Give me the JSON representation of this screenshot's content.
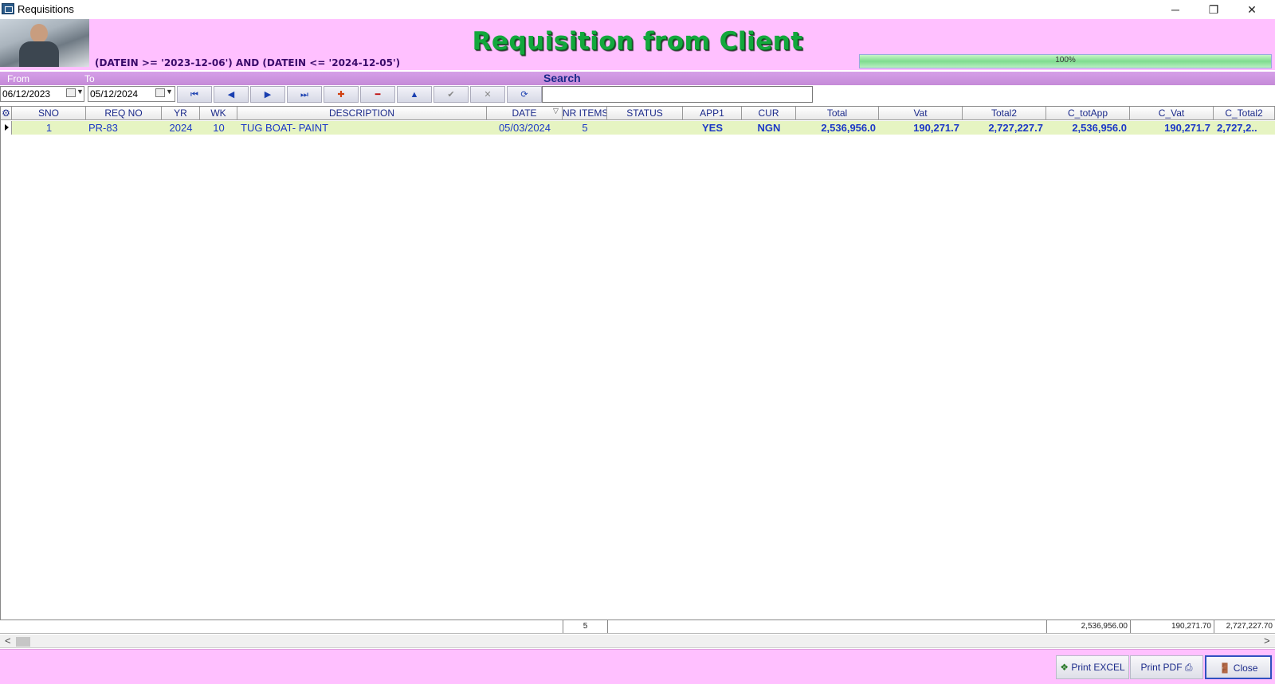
{
  "window": {
    "title": "Requisitions",
    "minimize_glyph": "─",
    "restore_glyph": "❐",
    "close_glyph": "✕"
  },
  "header": {
    "title": "Requisition from Client",
    "filter": "(DATEIN >= '2023-12-06') AND  (DATEIN  <= '2024-12-05')",
    "progress_label": "100%",
    "progress_value": 100
  },
  "search": {
    "from_label": "From",
    "to_label": "To",
    "label": "Search",
    "from_date": "06/12/2023",
    "to_date": "05/12/2024",
    "query": ""
  },
  "navigator": {
    "first": "⏮",
    "prior": "◀",
    "next": "▶",
    "last": "⏭",
    "insert": "✚",
    "delete": "━",
    "edit": "▲",
    "post": "✔",
    "cancel": "✕",
    "refresh": "⟳"
  },
  "grid": {
    "columns": [
      "SNO",
      "REQ NO",
      "YR",
      "WK",
      "DESCRIPTION",
      "DATE",
      "NR ITEMS",
      "STATUS",
      "APP1",
      "CUR",
      "Total",
      "Vat",
      "Total2",
      "C_totApp",
      "C_Vat",
      "C_Total2"
    ],
    "rows": [
      {
        "sno": "1",
        "req_no": "PR-83",
        "yr": "2024",
        "wk": "10",
        "description": "TUG BOAT- PAINT",
        "date": "05/03/2024",
        "nr_items": "5",
        "status": "",
        "app1": "YES",
        "cur": "NGN",
        "total": "2,536,956.0",
        "vat": "190,271.7",
        "total2": "2,727,227.7",
        "c_totapp": "2,536,956.0",
        "c_vat": "190,271.7",
        "c_total2": "2,727,2.."
      }
    ],
    "totals": {
      "nr_items": "5",
      "c_totapp": "2,536,956.00",
      "c_vat": "190,271.70",
      "c_total2": "2,727,227.70"
    }
  },
  "buttons": {
    "print_excel": "Print EXCEL",
    "print_pdf": "Print PDF",
    "close": "Close"
  },
  "colors": {
    "header_bg": "#ffc0ff",
    "title_green": "#12a83c",
    "row_highlight": "#e6f4c2",
    "text_blue": "#1d39c7"
  }
}
